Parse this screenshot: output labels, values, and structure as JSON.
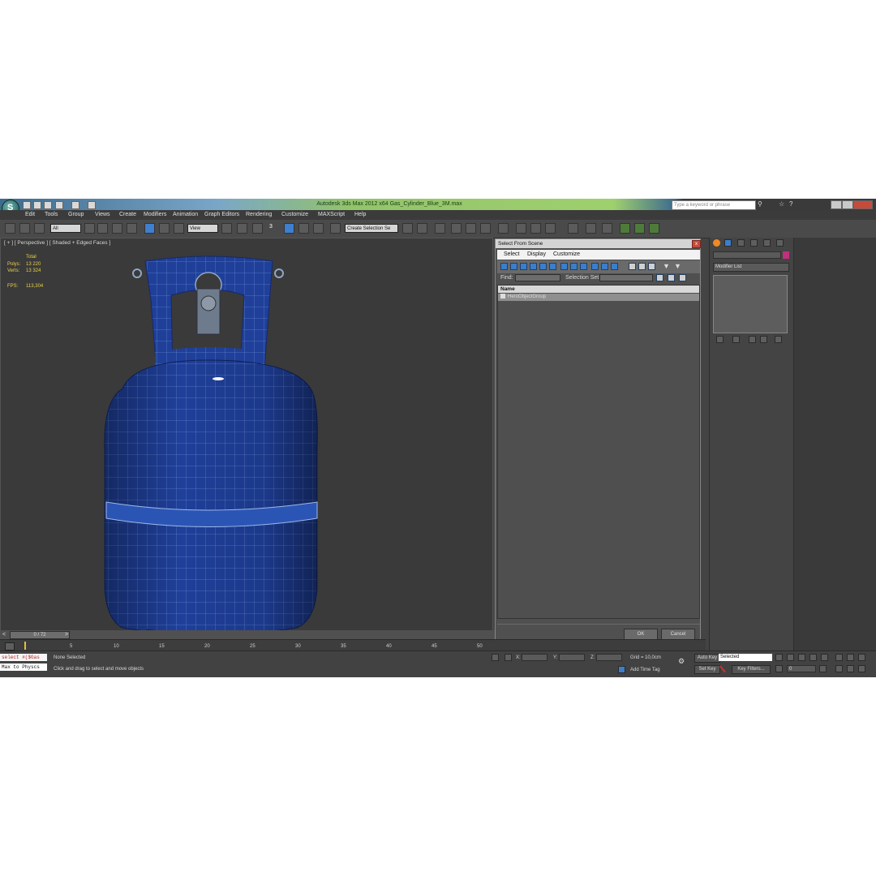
{
  "window": {
    "title": "Autodesk 3ds Max  2012 x64     Gas_Cylinder_Blue_3M.max",
    "search_placeholder": "Type a keyword or phrase"
  },
  "menu": [
    "Edit",
    "Tools",
    "Group",
    "Views",
    "Create",
    "Modifiers",
    "Animation",
    "Graph Editors",
    "Rendering",
    "Customize",
    "MAXScript",
    "Help"
  ],
  "toolbar": {
    "selection_filter": "All",
    "reference_coord": "View",
    "snap_value": "3",
    "named_selection": "Create Selection Se"
  },
  "viewport": {
    "label": "[ + ] [ Perspective ] [ Shaded + Edged Faces ]",
    "stats": {
      "total_label": "Total",
      "polys_label": "Polys:",
      "polys_value": "13 220",
      "verts_label": "Verts:",
      "verts_value": "13 324",
      "fps_label": "FPS:",
      "fps_value": "113,304"
    }
  },
  "dialog": {
    "title": "Select From Scene",
    "close": "x",
    "menu": [
      "Select",
      "Display",
      "Customize"
    ],
    "find_label": "Find:",
    "selection_set_label": "Selection Set:",
    "column_name": "Name",
    "items": [
      "HeroObjectGroup"
    ],
    "ok_label": "OK",
    "cancel_label": "Cancel"
  },
  "command_panel": {
    "modifier_list": "Modifier List"
  },
  "timeline": {
    "frame_counter": "0 / 72",
    "ticks": [
      "5",
      "10",
      "15",
      "20",
      "25",
      "30",
      "35",
      "40",
      "45",
      "50"
    ]
  },
  "statusbar": {
    "maxscript_line1": "select #($Gas",
    "maxscript_line2": "Max to Physcs",
    "selection_status": "None Selected",
    "prompt": "Click and drag to select and move objects",
    "x_label": "X:",
    "y_label": "Y:",
    "z_label": "Z:",
    "grid": "Grid = 10,0cm",
    "add_time_tag": "Add Time Tag",
    "auto_key": "Auto Key",
    "set_key": "Set Key",
    "key_mode": "Selected",
    "key_filters": "Key Filters...",
    "current_frame": "0"
  },
  "colors": {
    "cylinder": "#1f3f99",
    "wire": "#7aa0e6",
    "selected_tool": "#3e7fd0",
    "stats_text": "#e8d04a"
  }
}
